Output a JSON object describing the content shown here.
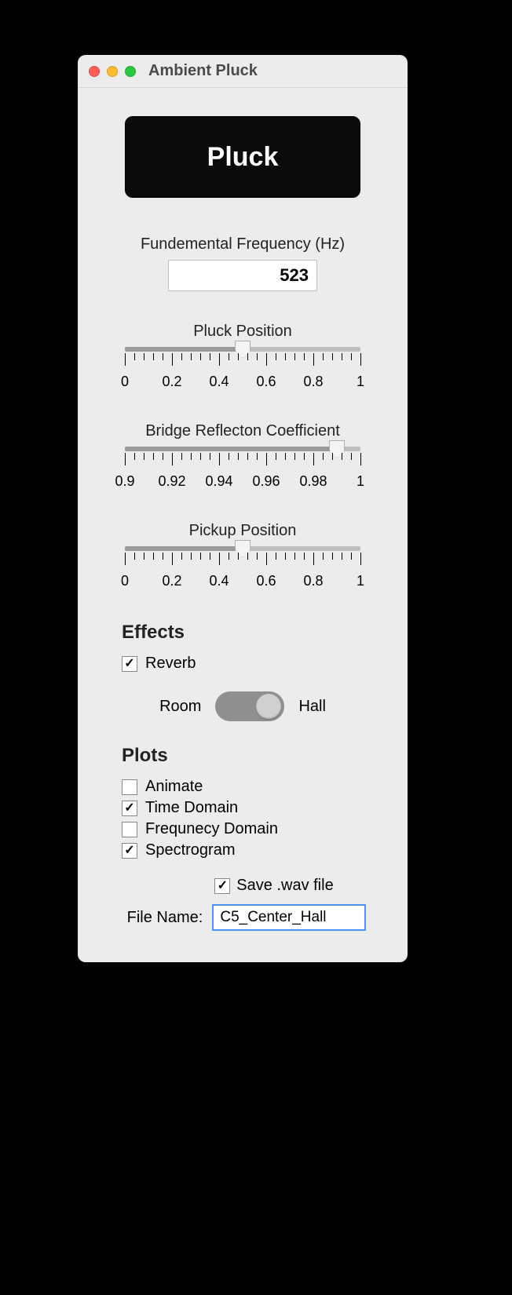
{
  "window": {
    "title": "Ambient Pluck"
  },
  "pluck": {
    "button_label": "Pluck"
  },
  "freq": {
    "label": "Fundemental Frequency (Hz)",
    "value": "523"
  },
  "sliders": {
    "pluck_pos": {
      "label": "Pluck Position",
      "value": 0.5,
      "min": 0,
      "max": 1,
      "ticks": [
        "0",
        "0.2",
        "0.4",
        "0.6",
        "0.8",
        "1"
      ]
    },
    "bridge": {
      "label": "Bridge Reflecton Coefficient",
      "value": 0.99,
      "min": 0.9,
      "max": 1,
      "ticks": [
        "0.9",
        "0.92",
        "0.94",
        "0.96",
        "0.98",
        "1"
      ]
    },
    "pickup": {
      "label": "Pickup Position",
      "value": 0.5,
      "min": 0,
      "max": 1,
      "ticks": [
        "0",
        "0.2",
        "0.4",
        "0.6",
        "0.8",
        "1"
      ]
    }
  },
  "effects": {
    "heading": "Effects",
    "reverb_label": "Reverb",
    "reverb_checked": true,
    "toggle_left": "Room",
    "toggle_right": "Hall",
    "toggle_state": "Hall"
  },
  "plots": {
    "heading": "Plots",
    "items": [
      {
        "label": "Animate",
        "checked": false
      },
      {
        "label": "Time Domain",
        "checked": true
      },
      {
        "label": "Frequnecy Domain",
        "checked": false
      },
      {
        "label": "Spectrogram",
        "checked": true
      }
    ]
  },
  "save": {
    "check_label": "Save .wav file",
    "checked": true,
    "file_label": "File Name:",
    "file_value": "C5_Center_Hall"
  }
}
